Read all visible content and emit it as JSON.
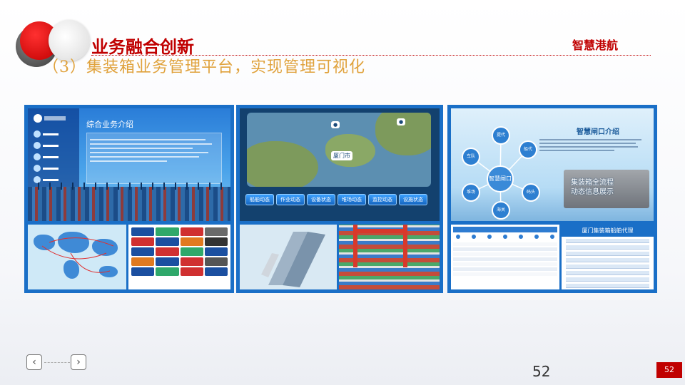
{
  "header": {
    "title": "业务融合创新",
    "subtitle": "（3）集装箱业务管理平台，实现管理可视化",
    "brand": "智慧港航"
  },
  "panel_1": {
    "heading": "综合业务介绍"
  },
  "panel_2": {
    "map_label": "厦门市",
    "tabs": [
      "船舶动态",
      "作业动态",
      "设备状态",
      "堆场动态",
      "监控动态",
      "设施状态"
    ]
  },
  "panel_3": {
    "title": "智慧闸口介绍",
    "hub_label": "智慧闸口",
    "nodes": [
      "提代",
      "车队",
      "船代",
      "堆场",
      "码头",
      "海关"
    ],
    "slogan_lines": [
      "集装箱全流程",
      "动态信息展示"
    ],
    "agents_title": "厦门集装箱船舶代理"
  },
  "footer": {
    "prev_icon": "‹",
    "next_icon": "›",
    "page_number": "52",
    "page_badge": "52"
  },
  "colors": {
    "accent_red": "#c00000",
    "subtitle_gold": "#e0a23c",
    "panel_blue": "#1a6fc7"
  }
}
